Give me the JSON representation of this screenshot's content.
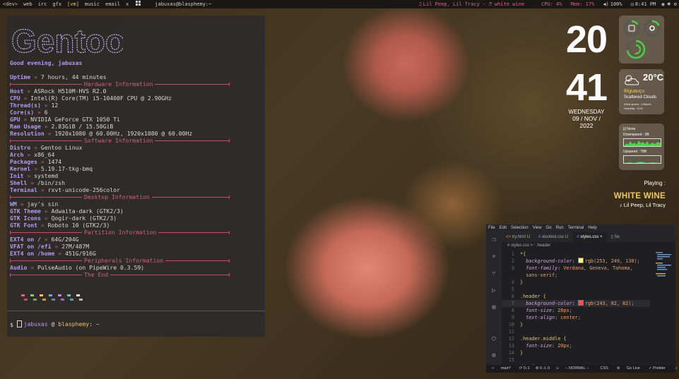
{
  "topbar": {
    "workspaces": [
      "<dev>",
      "web",
      "irc",
      "gfx",
      "[vm]",
      "music",
      "email",
      "x"
    ],
    "layout_icon": "grid-icon",
    "window_title": "jabuxas@blasphemy:~",
    "now_playing": "Lil Peep, Lil Tracy - ♬ white wine",
    "cpu": "CPU: 4%",
    "mem": "Mem: 17%",
    "volume": "100%",
    "time": "8:41 PM"
  },
  "terminal": {
    "logo_text": "Gentoo",
    "greeting": "Good evening, jabuxas",
    "uptime_key": "Uptime",
    "uptime": "7 hours, 44 minutes",
    "sections": {
      "hardware": "Hardware Information",
      "software": "Software Information",
      "desktop": "Desktop Information",
      "partition": "Partition Information",
      "peripherals": "Peripherals Information",
      "end": "The End"
    },
    "hardware": [
      {
        "k": "Host",
        "v": "ASRock H510M-HVS R2.0"
      },
      {
        "k": "CPU",
        "v": "Intel(R) Core(TM) i5-10400F CPU @ 2.90GHz"
      },
      {
        "k": "Thread(s)",
        "v": "12"
      },
      {
        "k": "Core(s)",
        "v": "6"
      },
      {
        "k": "GPU",
        "v": "NVIDIA GeForce GTX 1050 Ti"
      },
      {
        "k": "Ram Usage",
        "v": "2.83GiB / 15.50GiB"
      },
      {
        "k": "Resolution",
        "v": "1920x1080 @ 60.00Hz, 1920x1080 @ 60.00Hz"
      }
    ],
    "software": [
      {
        "k": "Distro",
        "v": "Gentoo Linux"
      },
      {
        "k": "Arch",
        "v": "x86_64"
      },
      {
        "k": "Packages",
        "v": "1474"
      },
      {
        "k": "Kernel",
        "v": "5.19.17-tkg-bmq"
      },
      {
        "k": "Init",
        "v": "systemd"
      },
      {
        "k": "Shell",
        "v": "/bin/zsh"
      },
      {
        "k": "Terminal",
        "v": "rxvt-unicode-256color"
      }
    ],
    "desktop": [
      {
        "k": "WM",
        "v": "jay's sin"
      },
      {
        "k": "GTK Theme",
        "v": "Adwaita-dark (GTK2/3)"
      },
      {
        "k": "GTK Icons",
        "v": "Qogir-dark (GTK2/3)"
      },
      {
        "k": "GTK Font",
        "v": "Roboto 10 (GTK2/3)"
      }
    ],
    "partition": [
      {
        "k": "EXT4 on /",
        "v": "64G/204G"
      },
      {
        "k": "VFAT on /efi",
        "v": "27M/487M"
      },
      {
        "k": "EXT4 on /home",
        "v": "451G/916G"
      }
    ],
    "peripherals": [
      {
        "k": "Audio",
        "v": "PulseAudio (on PipeWire 0.3.59)"
      }
    ],
    "sep": "»",
    "palette": [
      "#e0607a",
      "#8fd060",
      "#e8c060",
      "#70a0e8",
      "#c080e0",
      "#60c8c8",
      "#e8e8e8"
    ],
    "prompt_user": "jabuxas",
    "prompt_at": "@",
    "prompt_host": "blasphemy",
    "prompt_path": ": ~",
    "prompt_symbol": "$"
  },
  "clock": {
    "hour": "20",
    "minute": "41",
    "weekday": "WEDNESDAY",
    "date": "09 / NOV / 2022"
  },
  "weather": {
    "temp": "20°C",
    "city": "Biguauçu",
    "condition": "Scattered Clouds",
    "wind": "Wind speed : 0.5km/h",
    "humidity": "Humidity : 91%"
  },
  "network": {
    "name": "None",
    "down": "Downspeed : 0B",
    "up": "Upspeed : 78B"
  },
  "player": {
    "label": "Playing :",
    "title": "WHITE WINE",
    "artist": "Lil Peep, Lil Tracy"
  },
  "vscode": {
    "menu": [
      "File",
      "Edit",
      "Selection",
      "View",
      "Go",
      "Run",
      "Terminal",
      "Help"
    ],
    "tabs": [
      {
        "label": "try.html",
        "mark": "U"
      },
      {
        "label": "alsotest.css",
        "mark": "U"
      },
      {
        "label": "styles.css",
        "mark": "×"
      },
      {
        "label": "Se",
        "mark": ""
      }
    ],
    "breadcrumb": "# styles.css > ‘ .header",
    "code": [
      {
        "n": "1",
        "t": "*{"
      },
      {
        "n": "2",
        "p": "background-color",
        "sw": "#fdf982",
        "v": "rgb(253, 249, 130);"
      },
      {
        "n": "3",
        "p": "font-family",
        "v": "Verdana, Geneva, Tahoma,"
      },
      {
        "n": "",
        "v": "sans-serif;"
      },
      {
        "n": "4",
        "t": "}"
      },
      {
        "n": "5",
        "t": ""
      },
      {
        "n": "6",
        "s": ".header {"
      },
      {
        "n": "7",
        "p": "background-color",
        "sw": "#f35252",
        "v": "rgb(243, 82, 82);"
      },
      {
        "n": "8",
        "p": "font-size",
        "v": "28px;"
      },
      {
        "n": "9",
        "p": "text-align",
        "v": "center;"
      },
      {
        "n": "10",
        "t": "}"
      },
      {
        "n": "11",
        "t": ""
      },
      {
        "n": "12",
        "s": ".header.middle {"
      },
      {
        "n": "13",
        "p": "font-size",
        "v": "20px;"
      },
      {
        "n": "14",
        "t": "}"
      },
      {
        "n": "15",
        "t": ""
      },
      {
        "n": "16",
        "s": "div {"
      }
    ],
    "status": {
      "branch": "main*",
      "sync": "⟳ 0↓1",
      "problems": "⊗ 0 ⚠ 0",
      "remote": "☺",
      "mode": "-- NORMAL --",
      "lang": "CSS",
      "golive": "Go Live",
      "prettier": "✓ Prettier",
      "bell": "♪"
    }
  }
}
